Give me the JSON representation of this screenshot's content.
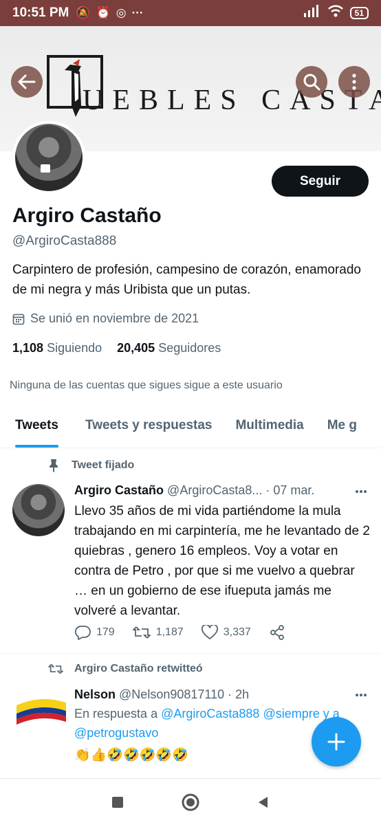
{
  "status_bar": {
    "time": "10:51 PM",
    "battery": "51"
  },
  "banner": {
    "brand_text": "UEBLES CASTAÑO"
  },
  "profile": {
    "follow_label": "Seguir",
    "name": "Argiro Castaño",
    "handle": "@ArgiroCasta888",
    "bio": "Carpintero de profesión, campesino de corazón, enamorado de mi negra y más Uribista que un putas.",
    "joined": "Se unió en noviembre de 2021",
    "following_count": "1,108",
    "following_label": "Siguiendo",
    "followers_count": "20,405",
    "followers_label": "Seguidores",
    "mutual_note": "Ninguna de las cuentas que sigues sigue a este usuario"
  },
  "tabs": [
    "Tweets",
    "Tweets y respuestas",
    "Multimedia",
    "Me g"
  ],
  "pinned_tweet": {
    "pinned_label": "Tweet fijado",
    "author": "Argiro Castaño",
    "handle": "@ArgiroCasta8...",
    "date": "· 07 mar.",
    "text": "Llevo 35 años de mi vida partiéndome la mula trabajando en mi carpintería, me he levantado de 2 quiebras , genero 16 empleos. Voy a votar en contra de Petro , por que si me vuelvo a quebrar … en un gobierno de ese ifueputa jamás me volveré a levantar.",
    "replies": "179",
    "retweets": "1,187",
    "likes": "3,337"
  },
  "retweet": {
    "retweet_label": "Argiro Castaño retwitteó",
    "author": "Nelson",
    "handle": "@Nelson90817110",
    "time": "· 2h",
    "reply_prefix": "En respuesta a",
    "reply_to_1": "@ArgiroCasta888",
    "reply_to_2": "@siempre y a",
    "reply_to_3": "@petrogustavo",
    "emojis": "👏👍🤣🤣🤣🤣🤣"
  },
  "colors": {
    "accent": "#1d9bf0",
    "status_bar": "#7a3f3c"
  }
}
